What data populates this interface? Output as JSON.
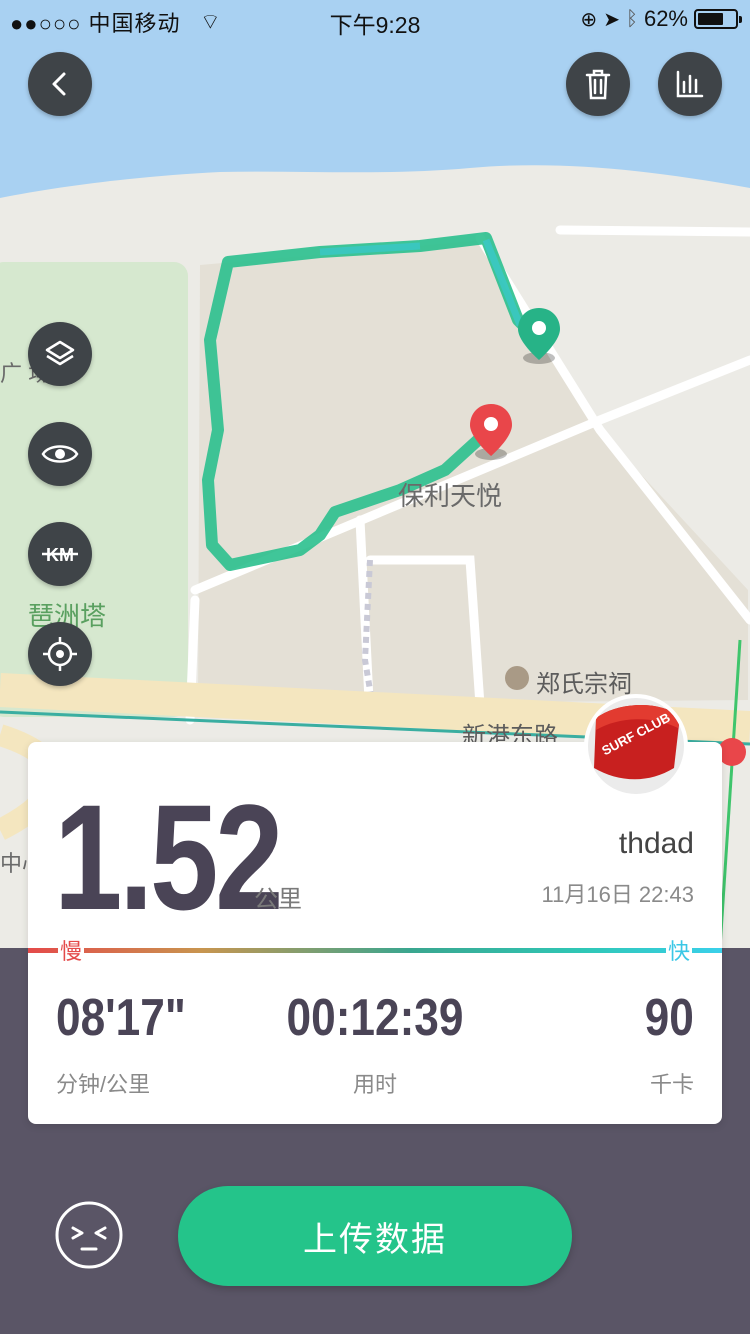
{
  "status_bar": {
    "carrier": "●●○○○ 中国移动",
    "time": "下午9:28",
    "battery": "62%"
  },
  "map": {
    "labels": {
      "poly_tianyue": "保利天悦",
      "pipa_tower": "琶洲塔",
      "zheng_shrine": "郑氏宗祠",
      "xingang_road": "新港东路",
      "left_square": "广 场",
      "left_center": "中心"
    },
    "icons": [
      "back-arrow-icon",
      "trash-icon",
      "chart-icon",
      "layers-icon",
      "eye-icon",
      "km-off-icon",
      "locate-icon"
    ],
    "route_color": "#2bc08e",
    "start_pin_color": "#27b387",
    "end_pin_color": "#e9464a"
  },
  "summary": {
    "distance": "1.52",
    "distance_unit": "公里",
    "username": "thdad",
    "datetime": "11月16日 22:43",
    "pace_slow_label": "慢",
    "pace_fast_label": "快",
    "avatar_text": "SURF CLUB",
    "stats": [
      {
        "value": "08'17\"",
        "label": "分钟/公里"
      },
      {
        "value": "00:12:39",
        "label": "用时"
      },
      {
        "value": "90",
        "label": "千卡"
      }
    ]
  },
  "bottom": {
    "upload_label": "上传数据",
    "face_icon": "smile-icon"
  },
  "colors": {
    "accent": "#24c48a",
    "dark_panel": "#5a5566",
    "slow": "#e44a4a",
    "fast": "#3ac7e6"
  }
}
